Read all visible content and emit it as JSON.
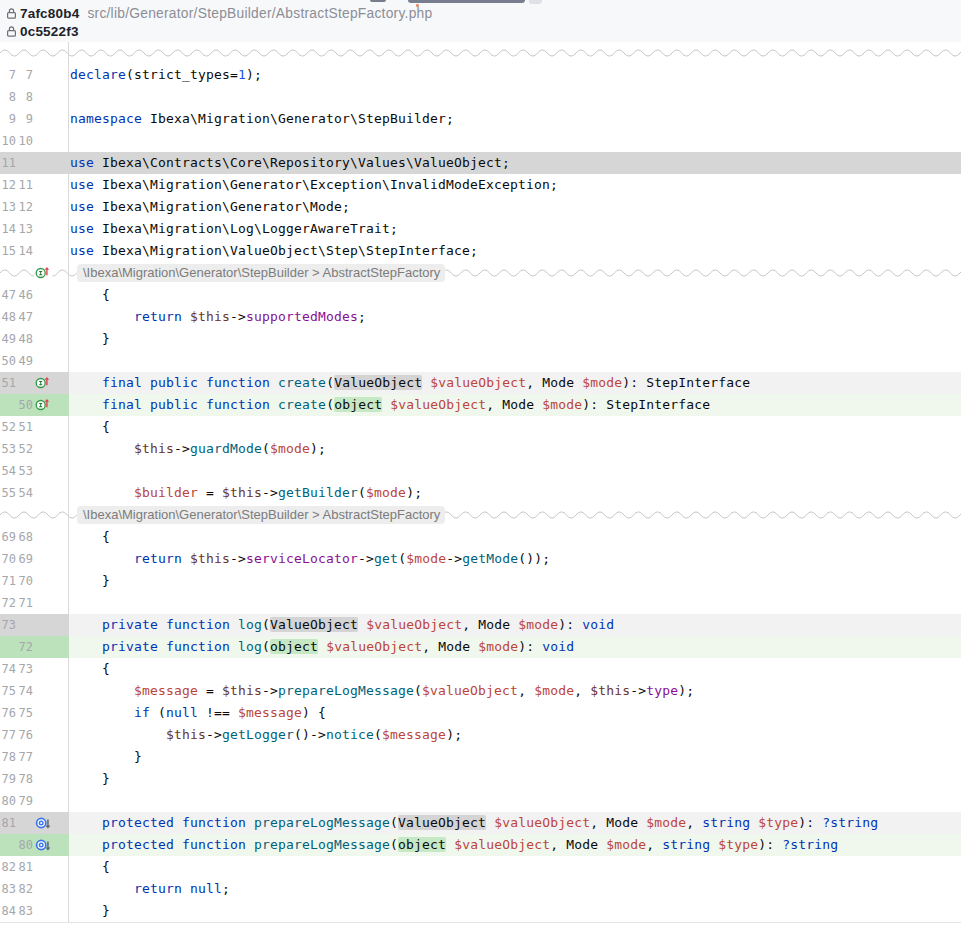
{
  "header": {
    "commit_old": "7afc80b4",
    "commit_new": "0c5522f3",
    "file_path": "src/lib/Generator/StepBuilder/AbstractStepFactory.php"
  },
  "fold_label": "\\Ibexa\\Migration\\Generator\\StepBuilder > AbstractStepFactory",
  "colors": {
    "header_bg": "#f7f8fa",
    "deleted_line_bg": "#d6d6d6",
    "deleted_changed_line_bg": "#f2f2f2",
    "deleted_word_bg": "#d4d4d4",
    "added_gutter_bg": "#bce2bb",
    "added_changed_line_bg": "#f0f8ee",
    "added_word_bg": "#c6e8c4",
    "keyword": "#0033b3",
    "function": "#00627a",
    "variable": "#bb4539",
    "this_variable": "#6a332b",
    "property": "#871094",
    "number": "#1750eb",
    "text": "#0a0a0a",
    "line_number": "#a5a7ab",
    "wave": "#c7c7c7"
  },
  "icons": {
    "impl": "implements-method-icon",
    "over": "overridden-method-icon",
    "lock": "lock-icon"
  },
  "rows": [
    {
      "t": "fold"
    },
    {
      "t": "code",
      "o": "7",
      "n": "7",
      "tok": [
        [
          "k",
          "declare"
        ],
        [
          "p",
          "(strict_types="
        ],
        [
          "n",
          "1"
        ],
        [
          "p",
          ");"
        ]
      ]
    },
    {
      "t": "code",
      "o": "8",
      "n": "8",
      "tok": []
    },
    {
      "t": "code",
      "o": "9",
      "n": "9",
      "tok": [
        [
          "k",
          "namespace"
        ],
        [
          "p",
          " Ibexa\\Migration\\Generator\\StepBuilder;"
        ]
      ]
    },
    {
      "t": "code",
      "o": "10",
      "n": "10",
      "tok": []
    },
    {
      "t": "code",
      "kind": "delfull",
      "o": "11",
      "n": "",
      "tok": [
        [
          "k",
          "use"
        ],
        [
          "p",
          " Ibexa\\Contracts\\Core\\Repository\\Values\\ValueObject;"
        ]
      ]
    },
    {
      "t": "code",
      "o": "12",
      "n": "11",
      "tok": [
        [
          "k",
          "use"
        ],
        [
          "p",
          " Ibexa\\Migration\\Generator\\Exception\\InvalidModeException;"
        ]
      ]
    },
    {
      "t": "code",
      "o": "13",
      "n": "12",
      "tok": [
        [
          "k",
          "use"
        ],
        [
          "p",
          " Ibexa\\Migration\\Generator\\Mode;"
        ]
      ]
    },
    {
      "t": "code",
      "o": "14",
      "n": "13",
      "tok": [
        [
          "k",
          "use"
        ],
        [
          "p",
          " Ibexa\\Migration\\Log\\LoggerAwareTrait;"
        ]
      ]
    },
    {
      "t": "code",
      "o": "15",
      "n": "14",
      "tok": [
        [
          "k",
          "use"
        ],
        [
          "p",
          " Ibexa\\Migration\\ValueObject\\Step\\StepInterface;"
        ]
      ]
    },
    {
      "t": "fold",
      "pill": true,
      "icon": "impl"
    },
    {
      "t": "code",
      "o": "47",
      "n": "46",
      "tok": [
        [
          "p",
          "    {"
        ]
      ]
    },
    {
      "t": "code",
      "o": "48",
      "n": "47",
      "tok": [
        [
          "p",
          "        "
        ],
        [
          "k",
          "return"
        ],
        [
          "p",
          " "
        ],
        [
          "th",
          "$this"
        ],
        [
          "p",
          "->"
        ],
        [
          "pr",
          "supportedModes"
        ],
        [
          "p",
          ";"
        ]
      ]
    },
    {
      "t": "code",
      "o": "49",
      "n": "48",
      "tok": [
        [
          "p",
          "    }"
        ]
      ]
    },
    {
      "t": "code",
      "o": "50",
      "n": "49",
      "tok": []
    },
    {
      "t": "code",
      "kind": "del",
      "o": "51",
      "n": "",
      "icon": "impl",
      "tok": [
        [
          "p",
          "    "
        ],
        [
          "k",
          "final"
        ],
        [
          "p",
          " "
        ],
        [
          "k",
          "public"
        ],
        [
          "p",
          " "
        ],
        [
          "k",
          "function"
        ],
        [
          "p",
          " "
        ],
        [
          "f",
          "create"
        ],
        [
          "p",
          "("
        ],
        [
          "hd",
          "ValueObject"
        ],
        [
          "p",
          " "
        ],
        [
          "v",
          "$valueObject"
        ],
        [
          "p",
          ", Mode "
        ],
        [
          "v",
          "$mode"
        ],
        [
          "p",
          "): StepInterface"
        ]
      ]
    },
    {
      "t": "code",
      "kind": "add",
      "o": "",
      "n": "50",
      "icon": "impl",
      "tok": [
        [
          "p",
          "    "
        ],
        [
          "k",
          "final"
        ],
        [
          "p",
          " "
        ],
        [
          "k",
          "public"
        ],
        [
          "p",
          " "
        ],
        [
          "k",
          "function"
        ],
        [
          "p",
          " "
        ],
        [
          "f",
          "create"
        ],
        [
          "p",
          "("
        ],
        [
          "hg",
          "object"
        ],
        [
          "p",
          " "
        ],
        [
          "v",
          "$valueObject"
        ],
        [
          "p",
          ", Mode "
        ],
        [
          "v",
          "$mode"
        ],
        [
          "p",
          "): StepInterface"
        ]
      ]
    },
    {
      "t": "code",
      "o": "52",
      "n": "51",
      "tok": [
        [
          "p",
          "    {"
        ]
      ]
    },
    {
      "t": "code",
      "o": "53",
      "n": "52",
      "tok": [
        [
          "p",
          "        "
        ],
        [
          "th",
          "$this"
        ],
        [
          "p",
          "->"
        ],
        [
          "f",
          "guardMode"
        ],
        [
          "p",
          "("
        ],
        [
          "v",
          "$mode"
        ],
        [
          "p",
          ");"
        ]
      ]
    },
    {
      "t": "code",
      "o": "54",
      "n": "53",
      "tok": []
    },
    {
      "t": "code",
      "o": "55",
      "n": "54",
      "tok": [
        [
          "p",
          "        "
        ],
        [
          "v",
          "$builder"
        ],
        [
          "p",
          " = "
        ],
        [
          "th",
          "$this"
        ],
        [
          "p",
          "->"
        ],
        [
          "f",
          "getBuilder"
        ],
        [
          "p",
          "("
        ],
        [
          "v",
          "$mode"
        ],
        [
          "p",
          ");"
        ]
      ]
    },
    {
      "t": "fold",
      "pill": true
    },
    {
      "t": "code",
      "o": "69",
      "n": "68",
      "tok": [
        [
          "p",
          "    {"
        ]
      ]
    },
    {
      "t": "code",
      "o": "70",
      "n": "69",
      "tok": [
        [
          "p",
          "        "
        ],
        [
          "k",
          "return"
        ],
        [
          "p",
          " "
        ],
        [
          "th",
          "$this"
        ],
        [
          "p",
          "->"
        ],
        [
          "pr",
          "serviceLocator"
        ],
        [
          "p",
          "->"
        ],
        [
          "f",
          "get"
        ],
        [
          "p",
          "("
        ],
        [
          "v",
          "$mode"
        ],
        [
          "p",
          "->"
        ],
        [
          "f",
          "getMode"
        ],
        [
          "p",
          "());"
        ]
      ]
    },
    {
      "t": "code",
      "o": "71",
      "n": "70",
      "tok": [
        [
          "p",
          "    }"
        ]
      ]
    },
    {
      "t": "code",
      "o": "72",
      "n": "71",
      "tok": []
    },
    {
      "t": "code",
      "kind": "del",
      "o": "73",
      "n": "",
      "tok": [
        [
          "p",
          "    "
        ],
        [
          "k",
          "private"
        ],
        [
          "p",
          " "
        ],
        [
          "k",
          "function"
        ],
        [
          "p",
          " "
        ],
        [
          "f",
          "log"
        ],
        [
          "p",
          "("
        ],
        [
          "hd",
          "ValueObject"
        ],
        [
          "p",
          " "
        ],
        [
          "v",
          "$valueObject"
        ],
        [
          "p",
          ", Mode "
        ],
        [
          "v",
          "$mode"
        ],
        [
          "p",
          "): "
        ],
        [
          "k",
          "void"
        ]
      ]
    },
    {
      "t": "code",
      "kind": "add",
      "o": "",
      "n": "72",
      "tok": [
        [
          "p",
          "    "
        ],
        [
          "k",
          "private"
        ],
        [
          "p",
          " "
        ],
        [
          "k",
          "function"
        ],
        [
          "p",
          " "
        ],
        [
          "f",
          "log"
        ],
        [
          "p",
          "("
        ],
        [
          "hg",
          "object"
        ],
        [
          "p",
          " "
        ],
        [
          "v",
          "$valueObject"
        ],
        [
          "p",
          ", Mode "
        ],
        [
          "v",
          "$mode"
        ],
        [
          "p",
          "): "
        ],
        [
          "k",
          "void"
        ]
      ]
    },
    {
      "t": "code",
      "o": "74",
      "n": "73",
      "tok": [
        [
          "p",
          "    {"
        ]
      ]
    },
    {
      "t": "code",
      "o": "75",
      "n": "74",
      "tok": [
        [
          "p",
          "        "
        ],
        [
          "v",
          "$message"
        ],
        [
          "p",
          " = "
        ],
        [
          "th",
          "$this"
        ],
        [
          "p",
          "->"
        ],
        [
          "f",
          "prepareLogMessage"
        ],
        [
          "p",
          "("
        ],
        [
          "v",
          "$valueObject"
        ],
        [
          "p",
          ", "
        ],
        [
          "v",
          "$mode"
        ],
        [
          "p",
          ", "
        ],
        [
          "th",
          "$this"
        ],
        [
          "p",
          "->"
        ],
        [
          "pr",
          "type"
        ],
        [
          "p",
          ");"
        ]
      ]
    },
    {
      "t": "code",
      "o": "76",
      "n": "75",
      "tok": [
        [
          "p",
          "        "
        ],
        [
          "k",
          "if"
        ],
        [
          "p",
          " ("
        ],
        [
          "k",
          "null"
        ],
        [
          "p",
          " !== "
        ],
        [
          "v",
          "$message"
        ],
        [
          "p",
          ") {"
        ]
      ]
    },
    {
      "t": "code",
      "o": "77",
      "n": "76",
      "tok": [
        [
          "p",
          "            "
        ],
        [
          "th",
          "$this"
        ],
        [
          "p",
          "->"
        ],
        [
          "f",
          "getLogger"
        ],
        [
          "p",
          "()->"
        ],
        [
          "f",
          "notice"
        ],
        [
          "p",
          "("
        ],
        [
          "v",
          "$message"
        ],
        [
          "p",
          ");"
        ]
      ]
    },
    {
      "t": "code",
      "o": "78",
      "n": "77",
      "tok": [
        [
          "p",
          "        }"
        ]
      ]
    },
    {
      "t": "code",
      "o": "79",
      "n": "78",
      "tok": [
        [
          "p",
          "    }"
        ]
      ]
    },
    {
      "t": "code",
      "o": "80",
      "n": "79",
      "tok": []
    },
    {
      "t": "code",
      "kind": "del",
      "o": "81",
      "n": "",
      "icon": "over",
      "tok": [
        [
          "p",
          "    "
        ],
        [
          "k",
          "protected"
        ],
        [
          "p",
          " "
        ],
        [
          "k",
          "function"
        ],
        [
          "p",
          " "
        ],
        [
          "f",
          "prepareLogMessage"
        ],
        [
          "p",
          "("
        ],
        [
          "hd",
          "ValueObject"
        ],
        [
          "p",
          " "
        ],
        [
          "v",
          "$valueObject"
        ],
        [
          "p",
          ", Mode "
        ],
        [
          "v",
          "$mode"
        ],
        [
          "p",
          ", "
        ],
        [
          "k",
          "string"
        ],
        [
          "p",
          " "
        ],
        [
          "v",
          "$type"
        ],
        [
          "p",
          "): "
        ],
        [
          "k",
          "?string"
        ]
      ]
    },
    {
      "t": "code",
      "kind": "add",
      "o": "",
      "n": "80",
      "icon": "over",
      "tok": [
        [
          "p",
          "    "
        ],
        [
          "k",
          "protected"
        ],
        [
          "p",
          " "
        ],
        [
          "k",
          "function"
        ],
        [
          "p",
          " "
        ],
        [
          "f",
          "prepareLogMessage"
        ],
        [
          "p",
          "("
        ],
        [
          "hg",
          "object"
        ],
        [
          "p",
          " "
        ],
        [
          "v",
          "$valueObject"
        ],
        [
          "p",
          ", Mode "
        ],
        [
          "v",
          "$mode"
        ],
        [
          "p",
          ", "
        ],
        [
          "k",
          "string"
        ],
        [
          "p",
          " "
        ],
        [
          "v",
          "$type"
        ],
        [
          "p",
          "): "
        ],
        [
          "k",
          "?string"
        ]
      ]
    },
    {
      "t": "code",
      "o": "82",
      "n": "81",
      "tok": [
        [
          "p",
          "    {"
        ]
      ]
    },
    {
      "t": "code",
      "o": "83",
      "n": "82",
      "tok": [
        [
          "p",
          "        "
        ],
        [
          "k",
          "return"
        ],
        [
          "p",
          " "
        ],
        [
          "k",
          "null"
        ],
        [
          "p",
          ";"
        ]
      ]
    },
    {
      "t": "code",
      "o": "84",
      "n": "83",
      "tok": [
        [
          "p",
          "    }"
        ]
      ]
    }
  ]
}
